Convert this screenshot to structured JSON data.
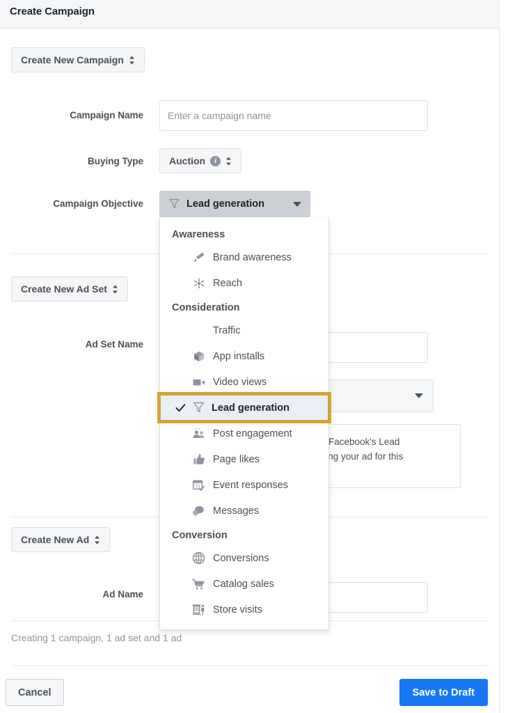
{
  "header": {
    "title": "Create Campaign"
  },
  "campaign_section": {
    "create_button": "Create New Campaign",
    "fields": {
      "campaign_name": {
        "label": "Campaign Name",
        "value": "",
        "placeholder": "Enter a campaign name"
      },
      "buying_type": {
        "label": "Buying Type",
        "value": "Auction",
        "info_glyph": "i"
      },
      "campaign_objective": {
        "label": "Campaign Objective",
        "value": "Lead generation",
        "icon": "funnel-icon",
        "caret": "chevron-down-icon"
      }
    }
  },
  "adset_section": {
    "create_button": "Create New Ad Set",
    "fields": {
      "adset_name": {
        "label": "Ad Set Name",
        "value": "",
        "placeholder": ""
      }
    },
    "hint_box": {
      "line1": "ot Facebook's Lead",
      "line2": "ating your ad for this"
    }
  },
  "ad_section": {
    "create_button": "Create New Ad",
    "fields": {
      "ad_name": {
        "label": "Ad Name",
        "value": "",
        "placeholder": ""
      }
    }
  },
  "status": {
    "text": "Creating 1 campaign, 1 ad set and 1 ad"
  },
  "footer": {
    "cancel_label": "Cancel",
    "save_label": "Save to Draft"
  },
  "objective_menu": {
    "groups": [
      {
        "title": "Awareness",
        "items": [
          {
            "label": "Brand awareness",
            "icon": "megaphone-icon",
            "selected": false,
            "has_icon": true
          },
          {
            "label": "Reach",
            "icon": "starburst-icon",
            "selected": false,
            "has_icon": true
          }
        ]
      },
      {
        "title": "Consideration",
        "items": [
          {
            "label": "Traffic",
            "icon": "",
            "selected": false,
            "has_icon": false
          },
          {
            "label": "App installs",
            "icon": "cube-icon",
            "selected": false,
            "has_icon": true
          },
          {
            "label": "Video views",
            "icon": "video-camera-icon",
            "selected": false,
            "has_icon": true
          },
          {
            "label": "Lead generation",
            "icon": "funnel-icon",
            "selected": true,
            "has_icon": true
          },
          {
            "label": "Post engagement",
            "icon": "people-group-icon",
            "selected": false,
            "has_icon": true
          },
          {
            "label": "Page likes",
            "icon": "thumbs-up-icon",
            "selected": false,
            "has_icon": true
          },
          {
            "label": "Event responses",
            "icon": "calendar-check-icon",
            "selected": false,
            "has_icon": true
          },
          {
            "label": "Messages",
            "icon": "chat-bubbles-icon",
            "selected": false,
            "has_icon": true
          }
        ]
      },
      {
        "title": "Conversion",
        "items": [
          {
            "label": "Conversions",
            "icon": "globe-icon",
            "selected": false,
            "has_icon": true
          },
          {
            "label": "Catalog sales",
            "icon": "shopping-cart-icon",
            "selected": false,
            "has_icon": true
          },
          {
            "label": "Store visits",
            "icon": "storefront-icon",
            "selected": false,
            "has_icon": true
          }
        ]
      }
    ]
  },
  "colors": {
    "accent_blue": "#1877f2",
    "highlight_gold": "#d4a437",
    "selected_row_bg": "#eaeff6",
    "header_bg": "#f5f6f7",
    "text_primary": "#1d2129",
    "text_secondary": "#4b4f56",
    "text_muted": "#8d949e"
  }
}
